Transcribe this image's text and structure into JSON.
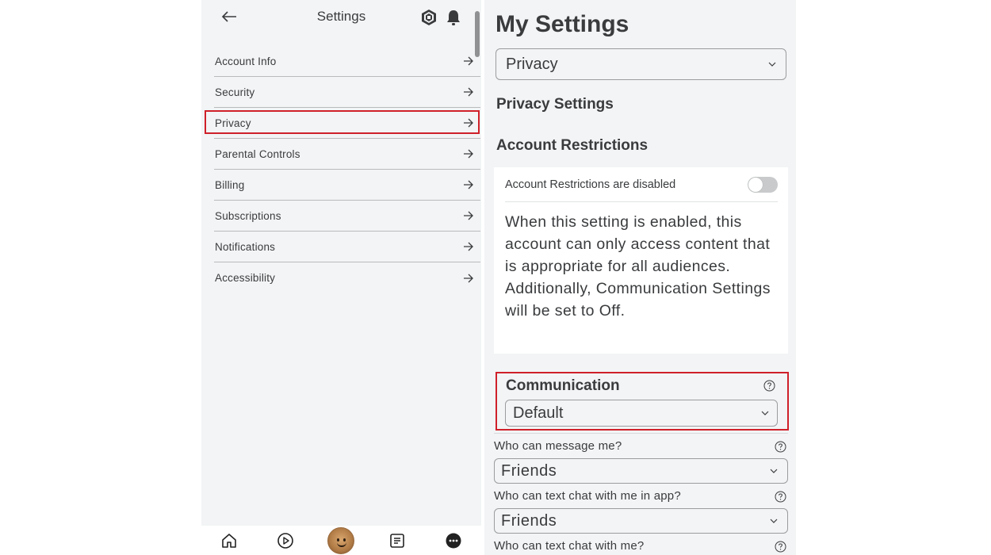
{
  "left": {
    "title": "Settings",
    "menu": [
      {
        "label": "Account Info"
      },
      {
        "label": "Security"
      },
      {
        "label": "Privacy",
        "selected": true
      },
      {
        "label": "Parental Controls"
      },
      {
        "label": "Billing"
      },
      {
        "label": "Subscriptions"
      },
      {
        "label": "Notifications"
      },
      {
        "label": "Accessibility"
      }
    ],
    "bottom_nav": [
      "home-icon",
      "play-icon",
      "avatar",
      "chat-icon",
      "more-icon"
    ]
  },
  "right": {
    "page_title": "My Settings",
    "category_select": "Privacy",
    "privacy_heading": "Privacy Settings",
    "restrictions_heading": "Account Restrictions",
    "restrictions_toggle_label": "Account Restrictions are disabled",
    "restrictions_enabled": false,
    "restrictions_description": "When this setting is enabled, this account can only access content that is appropriate for all audiences. Additionally, Communication Settings will be set to Off.",
    "communication_heading": "Communication",
    "communication_value": "Default",
    "questions": [
      {
        "label": "Who can message me?",
        "value": "Friends"
      },
      {
        "label": "Who can text chat with me in app?",
        "value": "Friends"
      },
      {
        "label": "Who can text chat with me?",
        "value": ""
      }
    ]
  },
  "colors": {
    "highlight": "#d0202a",
    "panel_bg": "#f2f4f5",
    "text": "#393b3d"
  }
}
